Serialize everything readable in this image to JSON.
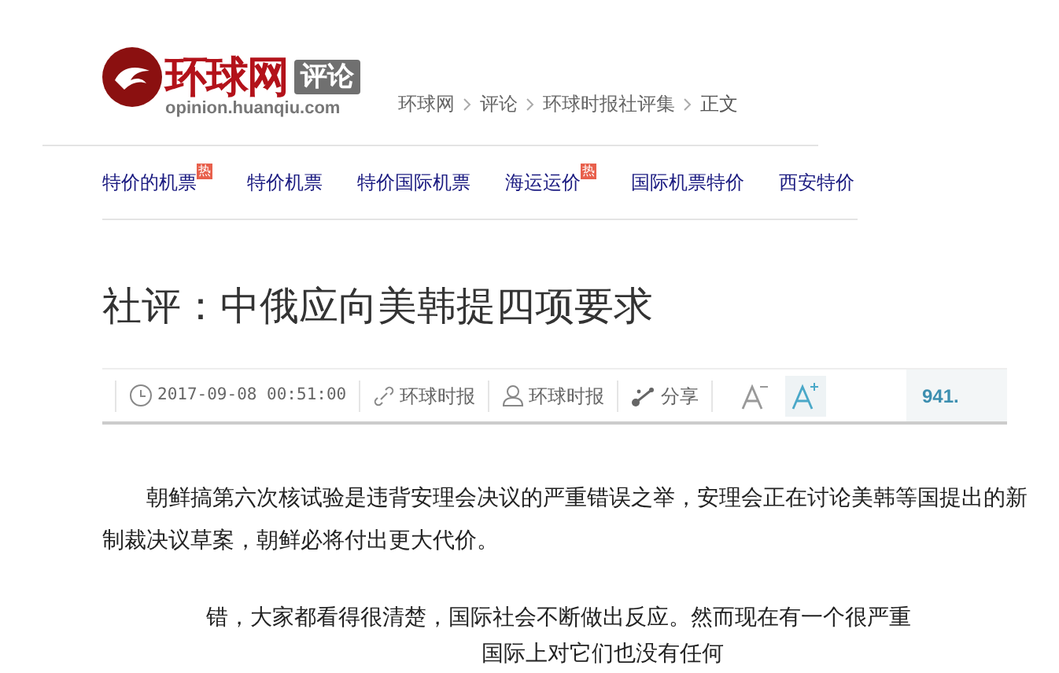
{
  "logo": {
    "name": "环球网",
    "section": "评论",
    "domain": "opinion.huanqiu.com"
  },
  "breadcrumb": [
    "环球网",
    "评论",
    "环球时报社评集",
    "正文"
  ],
  "nav": [
    {
      "label": "特价的机票",
      "badge": "热"
    },
    {
      "label": "特价机票"
    },
    {
      "label": "特价国际机票"
    },
    {
      "label": "海运运价",
      "badge": "热"
    },
    {
      "label": "国际机票特价"
    },
    {
      "label": "西安特价"
    }
  ],
  "title": "社评：中俄应向美韩提四项要求",
  "meta": {
    "time": "2017-09-08 00:51:00",
    "source": "环球时报",
    "author": "环球时报",
    "share": "分享",
    "count": "941."
  },
  "font_buttons": [
    {
      "kind": "smaller",
      "selected": false
    },
    {
      "kind": "larger",
      "selected": true
    }
  ],
  "paragraphs": [
    {
      "text": "朝鲜搞第六次核试验是违背安理会决议的严重错误之举，安理会正在讨论美韩等国提出的新制裁决议草案，朝鲜必将付出更大代价。"
    },
    {
      "text": "错，大家都看得很清楚，国际社会不断做出反应。然而现在有一个很严重"
    },
    {
      "text": "国际上对它们也没有任何"
    }
  ]
}
